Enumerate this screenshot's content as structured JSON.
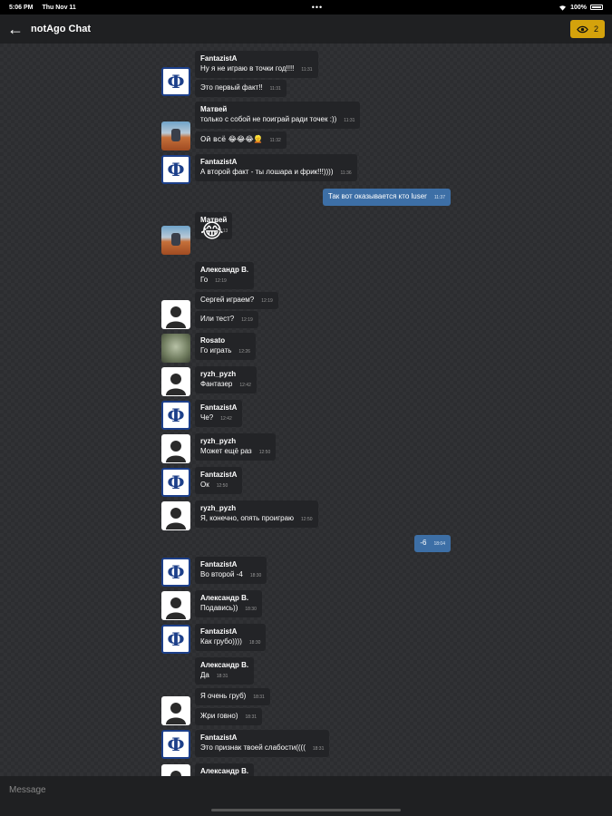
{
  "status": {
    "time": "5:06 PM",
    "date": "Thu Nov 11",
    "battery": "100%",
    "dots": "•••"
  },
  "header": {
    "back_icon": "arrow-left-icon",
    "title": "notAgo Chat",
    "viewer_icon": "eye-icon",
    "viewer_count": "2"
  },
  "messages": [
    {
      "author": "FantazistA",
      "text": "Ну я не играю в точки год!!!!",
      "time": "11:31"
    },
    {
      "text": "Это первый факт!!",
      "time": "11:31"
    },
    {
      "author": "Матвей",
      "text": "только с собой не поиграй ради точек :))",
      "time": "11:31"
    },
    {
      "text": "Ой всё 😂😂😂👱",
      "time": "11:32"
    },
    {
      "author": "FantazistA",
      "text": "А второй факт - ты лошара и фрик!!!))))",
      "time": "11:36"
    },
    {
      "text": "Так вот оказывается кто luser",
      "time": "11:37"
    },
    {
      "author": "Матвей",
      "text": "😂",
      "time": "12:13"
    },
    {
      "author": "Александр В.",
      "text": "Го",
      "time": "12:19"
    },
    {
      "text": "Сергей играем?",
      "time": "12:19"
    },
    {
      "text": "Или тест?",
      "time": "12:19"
    },
    {
      "author": "Rosato",
      "text": "Го играть",
      "time": "12:26"
    },
    {
      "author": "ryzh_pyzh",
      "text": "Фантазер",
      "time": "12:42"
    },
    {
      "author": "FantazistA",
      "text": "Че?",
      "time": "12:42"
    },
    {
      "author": "ryzh_pyzh",
      "text": "Может ещё раз",
      "time": "12:50"
    },
    {
      "author": "FantazistA",
      "text": "Ок",
      "time": "12:50"
    },
    {
      "author": "ryzh_pyzh",
      "text": "Я, конечно, опять проиграю",
      "time": "12:50"
    },
    {
      "text": "-6",
      "time": "18:04"
    },
    {
      "author": "FantazistA",
      "text": "Во второй -4",
      "time": "18:30"
    },
    {
      "author": "Александр В.",
      "text": "Подавись))",
      "time": "18:30"
    },
    {
      "author": "FantazistA",
      "text": "Как грубо))))",
      "time": "18:30"
    },
    {
      "author": "Александр В.",
      "text": "Да",
      "time": "18:31"
    },
    {
      "text": "Я очень груб)",
      "time": "18:31"
    },
    {
      "text": "Жри говно)",
      "time": "18:31"
    },
    {
      "author": "FantazistA",
      "text": "Это признак твоей слабости((((",
      "time": "18:31"
    },
    {
      "author": "Александр В."
    }
  ],
  "avatars": {
    "fantazist_letter": "Ф"
  },
  "input": {
    "placeholder": "Message"
  }
}
